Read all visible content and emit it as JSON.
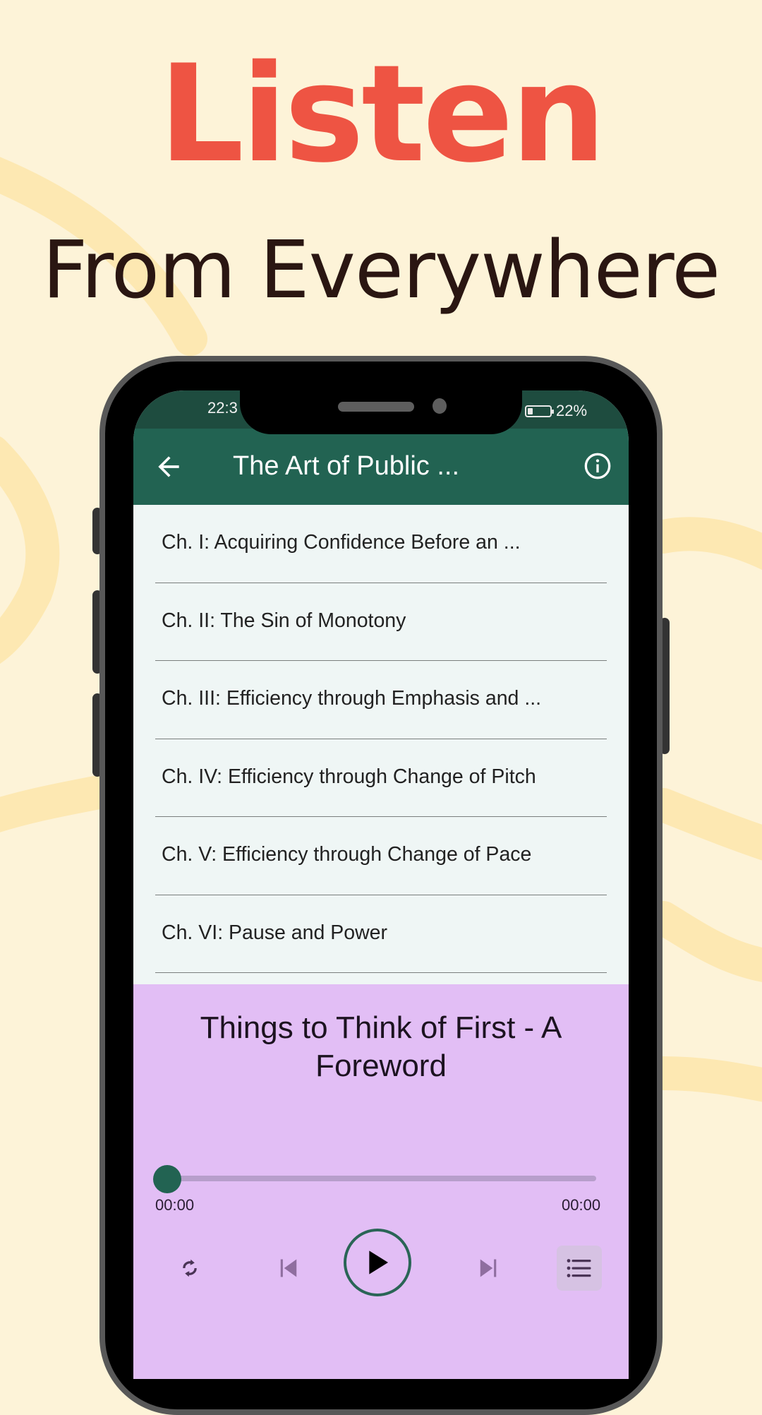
{
  "promo": {
    "headline_primary": "Listen",
    "headline_secondary": "From Everywhere",
    "colors": {
      "background": "#fdf3d8",
      "swirl": "#fde8b2",
      "headline_primary": "#ee5443",
      "headline_secondary": "#2a1612"
    }
  },
  "status_bar": {
    "time": "22:3",
    "battery_percent": "22%",
    "battery_level": 0.22
  },
  "app_bar": {
    "title": "The Art of Public ...",
    "back_icon": "arrow-left-icon",
    "info_icon": "info-circle-icon",
    "color": "#226352"
  },
  "chapters": [
    {
      "label": "Ch. I: Acquiring Confidence Before an ..."
    },
    {
      "label": "Ch. II: The Sin of Monotony"
    },
    {
      "label": "Ch. III: Efficiency through Emphasis and ..."
    },
    {
      "label": "Ch. IV: Efficiency through Change of Pitch"
    },
    {
      "label": "Ch. V: Efficiency through Change of Pace"
    },
    {
      "label": "Ch. VI: Pause and Power"
    }
  ],
  "player": {
    "now_playing": "Things to Think of First - A Foreword",
    "position": "00:00",
    "duration": "00:00",
    "progress": 0,
    "background": "#e2bef5",
    "controls": [
      {
        "name": "repeat",
        "icon": "repeat-icon"
      },
      {
        "name": "previous",
        "icon": "skip-previous-icon"
      },
      {
        "name": "play",
        "icon": "play-icon"
      },
      {
        "name": "next",
        "icon": "skip-next-icon"
      },
      {
        "name": "playlist",
        "icon": "playlist-icon"
      }
    ]
  }
}
